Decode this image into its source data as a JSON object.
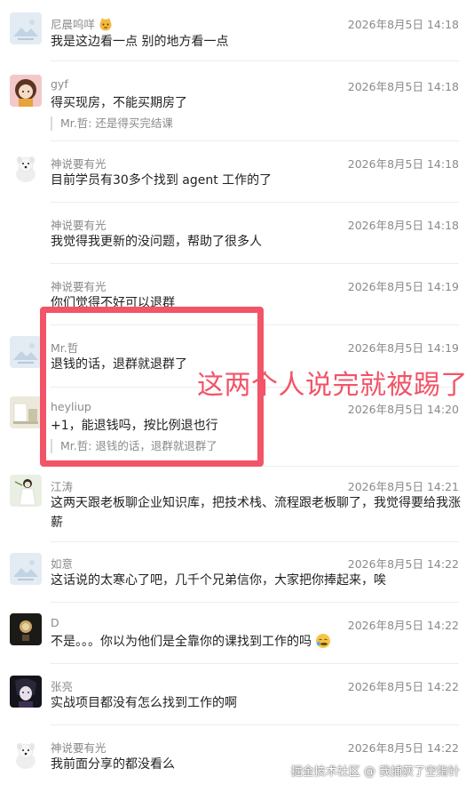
{
  "messages": [
    {
      "sender": "尼晨呜咩",
      "time": "2026年8月5日 14:18",
      "content": "我是这边看一点 别的地方看一点",
      "avatar": "placeholder-avatar"
    },
    {
      "sender": "gyf",
      "time": "2026年8月5日 14:18",
      "content": "得买现房，不能买期房了",
      "quote": "Mr.哲: 还是得买完结课",
      "avatar": "cartoon-girl-avatar"
    },
    {
      "sender": "神说要有光",
      "time": "2026年8月5日 14:18",
      "content": "目前学员有30多个找到 agent 工作的了",
      "avatar": "white-dog-avatar"
    },
    {
      "sender": "神说要有光",
      "time": "2026年8月5日 14:18",
      "content": "我觉得我更新的没问题，帮助了很多人"
    },
    {
      "sender": "神说要有光",
      "time": "2026年8月5日 14:19",
      "content": "你们觉得不好可以退群"
    },
    {
      "sender": "Mr.哲",
      "time": "2026年8月5日 14:19",
      "content": "退钱的话，退群就退群了",
      "avatar": "placeholder-avatar"
    },
    {
      "sender": "heyliup",
      "time": "2026年8月5日 14:20",
      "content": "+1，能退钱吗，按比例退也行",
      "quote": "Mr.哲: 退钱的话，退群就退群了",
      "avatar": "photo-avatar"
    },
    {
      "sender": "江涛",
      "time": "2026年8月5日 14:21",
      "content": "这两天跟老板聊企业知识库，把技术栈、流程跟老板聊了，我觉得要给我涨薪",
      "avatar": "anime-figure-avatar"
    },
    {
      "sender": "如意",
      "time": "2026年8月5日 14:22",
      "content": "这话说的太寒心了吧，几千个兄弟信你，大家把你捧起来，唉",
      "avatar": "placeholder-avatar"
    },
    {
      "sender": "D",
      "time": "2026年8月5日 14:22",
      "content": "不是。。。你以为他们是全靠你的课找到工作的吗",
      "avatar": "dark-photo-avatar"
    },
    {
      "sender": "张亮",
      "time": "2026年8月5日 14:22",
      "content": "实战项目都没有怎么找到工作的啊",
      "avatar": "dark-anime-avatar"
    },
    {
      "sender": "神说要有光",
      "time": "2026年8月5日 14:22",
      "content": "我前面分享的都没看么",
      "avatar": "white-dog-avatar"
    }
  ],
  "annotation": {
    "text": "这两个人说完就被踢了",
    "color": "#f25468"
  },
  "watermark": "掘金技术社区 @ 我捕获了空指针",
  "colors": {
    "muted": "#8a8a8a",
    "text": "#1f1f1f",
    "highlight": "#f25468"
  }
}
